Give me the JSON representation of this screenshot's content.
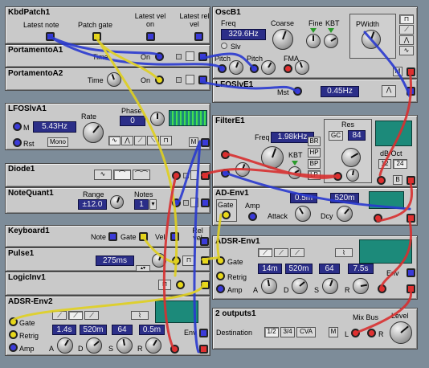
{
  "kbd": {
    "title": "KbdPatch1",
    "latest_note": "Latest note",
    "patch_gate": "Patch gate",
    "latest_vel_on": "Latest vel on",
    "latest_rel_vel": "Latest rel vel"
  },
  "porta1": {
    "title": "PortamentoA1",
    "time": "Time",
    "on": "On"
  },
  "porta2": {
    "title": "PortamentoA2",
    "time": "Time",
    "on": "On"
  },
  "osc": {
    "title": "OscB1",
    "freq_label": "Freq",
    "freq_value": "329.6Hz",
    "slv": "Slv",
    "coarse": "Coarse",
    "fine": "Fine",
    "kbt": "KBT",
    "pwidth": "PWidth",
    "pitch1": "Pitch",
    "pitch2": "Pitch",
    "fma": "FMA",
    "mute": "M"
  },
  "lfoslv_e": {
    "title": "LFOSlvE1",
    "mst": "Mst",
    "rate_value": "0.45Hz"
  },
  "lfoslv_a": {
    "title": "LFOSlvA1",
    "rate": "Rate",
    "phase": "Phase",
    "phase_value": "0",
    "rate_value": "5.43Hz",
    "mst": "M",
    "rst": "Rst",
    "mono": "Mono",
    "mute": "M"
  },
  "filter": {
    "title": "FilterE1",
    "freq_label": "Freq",
    "freq_value": "1.98kHz",
    "kbt": "KBT",
    "modes": [
      "BR",
      "HP",
      "BP",
      "LP"
    ],
    "res": "Res",
    "gc": "GC",
    "res_value": "84",
    "slope": "dB/Oct",
    "slope_opts": [
      "12",
      "24"
    ],
    "bypass": "B"
  },
  "diode": {
    "title": "Diode1"
  },
  "notequant": {
    "title": "NoteQuant1",
    "range": "Range",
    "range_value": "±12.0",
    "notes": "Notes",
    "notes_value": "1"
  },
  "adenv": {
    "title": "AD-Env1",
    "attack_value": "0.5m",
    "decay_value": "520m",
    "gate": "Gate",
    "amp": "Amp",
    "attack": "Attack",
    "decay": "Dcy"
  },
  "keyboard": {
    "title": "Keyboard1",
    "note": "Note",
    "gate": "Gate",
    "vel": "Vel",
    "rel_vel": "Rel vel"
  },
  "pulse": {
    "title": "Pulse1",
    "time_value": "275ms"
  },
  "logicinv": {
    "title": "LogicInv1"
  },
  "adsr1": {
    "title": "ADSR-Env1",
    "gate": "Gate",
    "retrig": "Retrig",
    "amp": "Amp",
    "a": "A",
    "d": "D",
    "s": "S",
    "r": "R",
    "a_value": "14m",
    "d_value": "520m",
    "s_value": "64",
    "r_value": "7.5s",
    "env": "Env"
  },
  "adsr2": {
    "title": "ADSR-Env2",
    "gate": "Gate",
    "retrig": "Retrig",
    "amp": "Amp",
    "a": "A",
    "d": "D",
    "s": "S",
    "r": "R",
    "a_value": "1.4s",
    "d_value": "520m",
    "s_value": "64",
    "r_value": "0.5m",
    "env": "Env"
  },
  "out": {
    "title": "2 outputs1",
    "destination": "Destination",
    "dest_opts": [
      "1/2",
      "3/4",
      "CVA"
    ],
    "mute": "M",
    "mix_bus": "Mix Bus",
    "level": "Level",
    "l": "L",
    "r": "R"
  },
  "colors": {
    "bg": "#7d8c99",
    "panel": "#c9c9c9",
    "display": "#2b2e88",
    "graph": "#1c8a7a",
    "cable_blue": "#2a3ad0",
    "cable_red": "#d83030",
    "cable_yellow": "#e0d020"
  }
}
